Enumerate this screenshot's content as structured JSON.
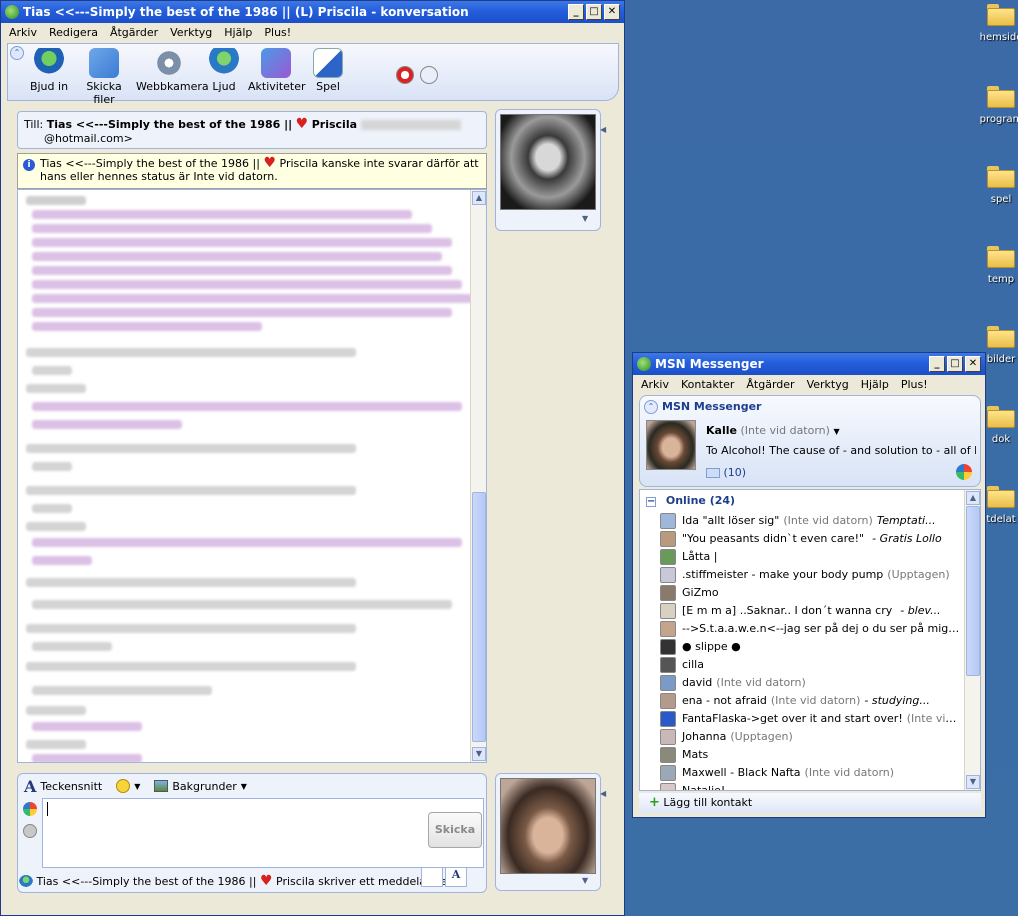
{
  "desktop": {
    "icons": [
      {
        "label": "hemsido"
      },
      {
        "label": "program"
      },
      {
        "label": "spel"
      },
      {
        "label": "temp"
      },
      {
        "label": "bilder"
      },
      {
        "label": "dok"
      },
      {
        "label": "tdelat"
      }
    ]
  },
  "conversation": {
    "title": "Tias <<---Simply the best of the 1986 || (L) Priscila - konversation",
    "menu": [
      "Arkiv",
      "Redigera",
      "Åtgärder",
      "Verktyg",
      "Hjälp",
      "Plus!"
    ],
    "toolbar": [
      "Bjud in",
      "Skicka filer",
      "Webbkamera",
      "Ljud",
      "Aktiviteter",
      "Spel"
    ],
    "to_label": "Till:",
    "to_name": "Tias <<---Simply the best of the 1986 ||",
    "to_name2": "Priscila",
    "to_email": "@hotmail.com>",
    "info_part1": "Tias <<---Simply the best of the 1986 ||",
    "info_part2": "Priscila kanske inte svarar därför att hans eller hennes status är Inte vid datorn.",
    "font_label": "Teckensnitt",
    "bg_label": "Bakgrunder",
    "send_label": "Skicka",
    "status_part1": "Tias <<---Simply the best of the 1986 ||",
    "status_part2": "Priscila skriver ett meddelande."
  },
  "messenger": {
    "title": "MSN Messenger",
    "menu": [
      "Arkiv",
      "Kontakter",
      "Åtgärder",
      "Verktyg",
      "Hjälp",
      "Plus!"
    ],
    "brand": "MSN Messenger",
    "user_name": "Kalle",
    "user_status": "(Inte vid datorn)",
    "user_message": "To Alcohol! The cause of - and solution to - all of lif...",
    "mail_count": "(10)",
    "group": "Online (24)",
    "contacts": [
      {
        "name": "Ida \"allt löser sig\"",
        "status": "(Inte vid datorn)",
        "extra": "Temptati..."
      },
      {
        "name": "\"You peasants didn`t even care!\"",
        "status": "",
        "extra": "- Gratis Lollo"
      },
      {
        "name": "Låtta |",
        "status": "",
        "extra": ""
      },
      {
        "name": ".stiffmeister - make your body pump",
        "status": "(Upptagen)",
        "extra": ""
      },
      {
        "name": "GiZmo",
        "status": "",
        "extra": ""
      },
      {
        "name": "[E m m a]     ..Saknar..    I don´t wanna cry",
        "status": "",
        "extra": "- blev..."
      },
      {
        "name": "-->S.t.a.a.w.e.n<--jag ser på dej o du ser på mig o ...",
        "status": "",
        "extra": ""
      },
      {
        "name": "● slippe ●",
        "status": "",
        "extra": ""
      },
      {
        "name": "cilla",
        "status": "",
        "extra": ""
      },
      {
        "name": "david",
        "status": "(Inte vid datorn)",
        "extra": ""
      },
      {
        "name": "ena - not afraid",
        "status": "(Inte vid datorn)",
        "extra": "- studying..."
      },
      {
        "name": "FantaFlaska->get over it and start over!",
        "status": "(Inte vid d...",
        "extra": ""
      },
      {
        "name": "Johanna",
        "status": "(Upptagen)",
        "extra": ""
      },
      {
        "name": "Mats",
        "status": "",
        "extra": ""
      },
      {
        "name": "Maxwell - Black Nafta",
        "status": "(Inte vid datorn)",
        "extra": ""
      },
      {
        "name": "Natalie!",
        "status": "",
        "extra": ""
      }
    ],
    "add_contact": "Lägg till kontakt"
  }
}
